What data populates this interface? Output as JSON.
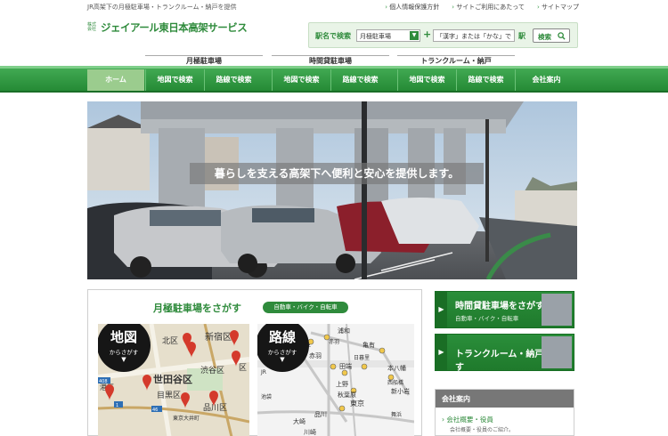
{
  "topbar": {
    "tagline": "JR高架下の月極駐車場・トランクルーム・納戸を提供",
    "links": [
      "個人情報保護方針",
      "サイトご利用にあたって",
      "サイトマップ"
    ]
  },
  "header": {
    "logo_badge": "株式会社",
    "logo_name": "ジェイアール東日本高架サービス"
  },
  "search": {
    "label": "駅名で検索",
    "select_value": "月極駐車場",
    "plus": "+",
    "input_value": "「漢字」または「かな」で",
    "eki": "駅",
    "button": "検索"
  },
  "categories": [
    "月極駐車場",
    "時間貸駐車場",
    "トランクルーム・納戸"
  ],
  "nav": [
    "ホーム",
    "地図で検索",
    "路線で検索",
    "地図で検索",
    "路線で検索",
    "地図で検索",
    "路線で検索",
    "会社案内"
  ],
  "hero": {
    "tagline": "暮らしを支える高架下へ便利と安心を提供します。"
  },
  "search_panel": {
    "title": "月極駐車場をさがす",
    "badge": "自動車・バイク・自転車",
    "map_label": "地図",
    "map_sub": "からさがす",
    "map_arrow": "▼",
    "line_label": "路線",
    "line_sub": "からさがす",
    "line_arrow": "▼",
    "map_places": [
      "北区",
      "新宿区",
      "渋谷区",
      "世田谷区",
      "目黒区",
      "品川区",
      "区",
      "東京大井町",
      "港区",
      "1",
      "46",
      "408"
    ],
    "line_places": [
      "浦和",
      "赤羽",
      "王子",
      "田端",
      "赤羽",
      "上野",
      "新小岩",
      "秋葉原",
      "東京",
      "品川",
      "大崎",
      "川崎",
      "亀有",
      "本八幡",
      "西船橋",
      "日暮里",
      "舞浜",
      "JR",
      "池袋"
    ]
  },
  "side_buttons": [
    {
      "title": "時間貸駐車場をさがす",
      "sub": "自動車・バイク・自転車",
      "arrow": "▶"
    },
    {
      "title": "トランクルーム・納戸をさがす",
      "sub": "",
      "arrow": "▶"
    }
  ],
  "about": {
    "heading": "会社案内",
    "item": "会社概要・役員",
    "desc": "会社概要・役員のご紹介。"
  },
  "icons": [
    "search-icon",
    "select-arrow-icon",
    "chevron-icon",
    "map-pin-icon",
    "play-arrow-icon"
  ],
  "colors": {
    "brand_green": "#2f8b3c",
    "nav_green": "#3aa04b"
  }
}
